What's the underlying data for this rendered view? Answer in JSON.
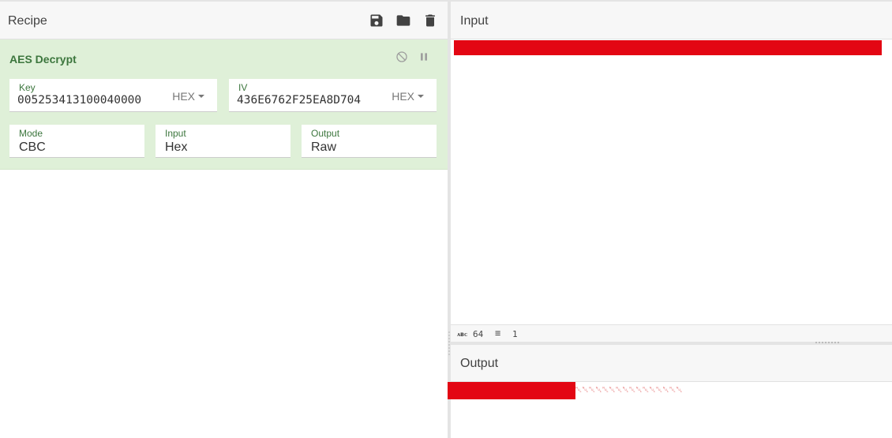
{
  "recipe": {
    "title": "Recipe",
    "header_icons": [
      "save-icon",
      "folder-icon",
      "trash-icon"
    ],
    "operation": {
      "name": "AES Decrypt",
      "controls": [
        "disable-icon",
        "pause-icon"
      ],
      "key": {
        "label": "Key",
        "value": "005253413100040000",
        "format": "HEX"
      },
      "iv": {
        "label": "IV",
        "value": "436E6762F25EA8D704",
        "format": "HEX"
      },
      "mode": {
        "label": "Mode",
        "value": "CBC"
      },
      "input": {
        "label": "Input",
        "value": "Hex"
      },
      "output": {
        "label": "Output",
        "value": "Raw"
      }
    }
  },
  "input_pane": {
    "title": "Input",
    "status": {
      "length": "64",
      "lines": "1"
    }
  },
  "output_pane": {
    "title": "Output",
    "text": "␀␀␀␀␀␀␀␀␀␀␀␀␀␀␀␀"
  },
  "colors": {
    "accent_green": "#3c763d",
    "op_background": "#dff0d8",
    "redaction": "#e30613"
  }
}
